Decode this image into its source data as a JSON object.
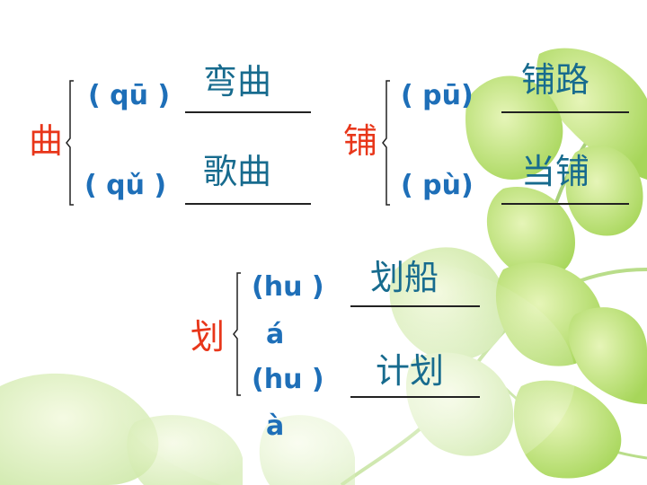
{
  "slide": {
    "groups": [
      {
        "char": "曲",
        "readings": [
          {
            "pinyin": "( qū )",
            "word": "弯曲"
          },
          {
            "pinyin": "( qǔ )",
            "word": "歌曲"
          }
        ]
      },
      {
        "char": "铺",
        "readings": [
          {
            "pinyin": "( pū)",
            "word": "铺路"
          },
          {
            "pinyin": "( pù)",
            "word": "当铺"
          }
        ]
      },
      {
        "char": "划",
        "readings": [
          {
            "pinyin": "(hu )",
            "pinyin_tail": "á",
            "word": "划船"
          },
          {
            "pinyin": "(hu )",
            "pinyin_tail": "à",
            "word": "计划"
          }
        ]
      }
    ]
  },
  "colors": {
    "head": "#e8361a",
    "pinyin": "#1e6fb8",
    "word": "#176b8e",
    "leaf_light": "#cfe88a",
    "leaf_dark": "#8cc63f"
  },
  "background": {
    "icon": "ivy-leaves-decoration"
  }
}
